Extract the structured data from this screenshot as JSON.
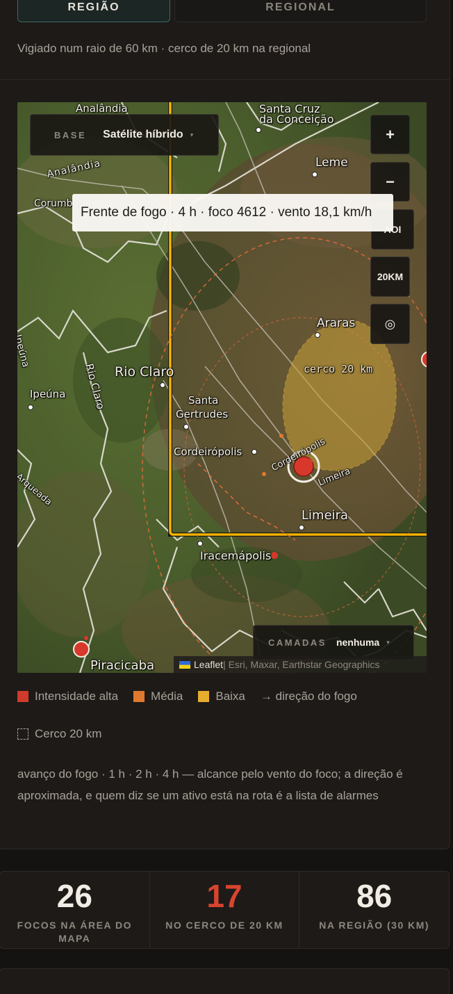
{
  "tabs": [
    {
      "label": "REGIÃO",
      "active": true
    },
    {
      "label": "REGIONAL",
      "active": false
    }
  ],
  "caption": "Vigiado num raio de 60 km · cerco de 20 km na regional",
  "map": {
    "base_control": {
      "label": "BASE",
      "value": "Satélite híbrido",
      "caret": "▾"
    },
    "zoom_controls": {
      "plus": "+",
      "minus": "−",
      "aoi": "AOI",
      "radius": "20KM",
      "locate": "◎"
    },
    "tooltip": "Frente de fogo · 4 h · foco 4612 · vento 18,1 km/h",
    "layers_control": {
      "label": "CAMADAS",
      "value": "nenhuma",
      "caret": "▾"
    },
    "attribution": {
      "leaflet": "Leaflet",
      "providers": " | Esri, Maxar, Earthstar Geographics"
    },
    "cerco_label": "cerco 20 km",
    "places": [
      "Analândia",
      "Analândia",
      "Santa Cruz",
      "da Conceição",
      "Leme",
      "Corumbataí",
      "Araras",
      "Rio Claro",
      "Ipeúna",
      "Santa",
      "Gertrudes",
      "Cordeirópolis",
      "Limeira",
      "Iracemápolis",
      "Piracicaba",
      "Ipeúna",
      "Rio Claro",
      "Arqueada",
      "Cordeirópolis",
      "Limeira"
    ],
    "colors": {
      "high": "#d8382b",
      "medium": "#e0792e",
      "low": "#e7ad2e",
      "aoi": "#f5b400"
    }
  },
  "legend": {
    "items": [
      {
        "label": "Intensidade alta",
        "color": "#d13b2c"
      },
      {
        "label": "Média",
        "color": "#e0792e"
      },
      {
        "label": "Baixa",
        "color": "#e7ad2e"
      }
    ],
    "direction": "→ direção do fogo",
    "cerco": "Cerco 20 km"
  },
  "note": "avanço do fogo · 1 h · 2 h · 4 h — alcance pelo vento do foco; a direção é aproximada, e quem diz se um ativo está na rota é a lista de alarmes",
  "stats": [
    {
      "value": "26",
      "label": "FOCOS NA ÁREA DO MAPA",
      "color": "#f2ede4"
    },
    {
      "value": "17",
      "label": "NO CERCO DE 20 KM",
      "color": "#d8442f"
    },
    {
      "value": "86",
      "label": "NA REGIÃO (30 KM)",
      "color": "#f2ede4"
    }
  ]
}
